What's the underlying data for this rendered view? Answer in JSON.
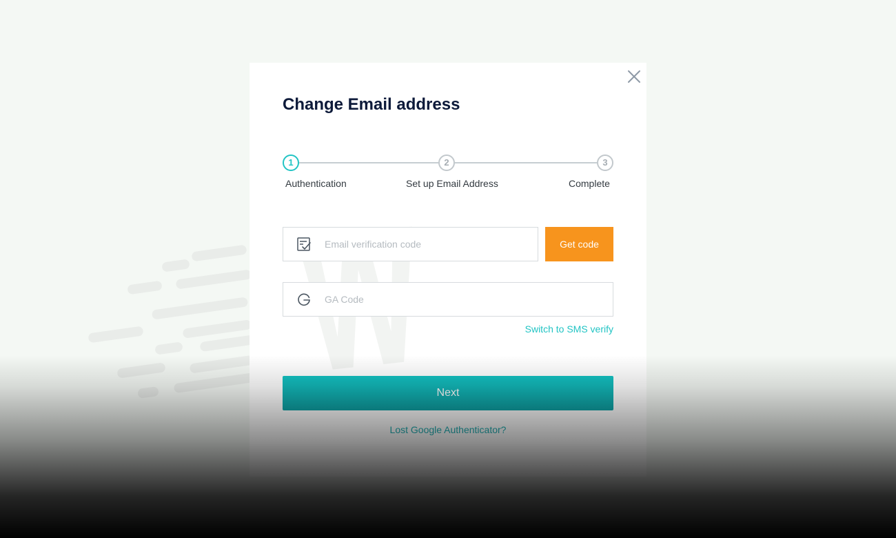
{
  "modal": {
    "title": "Change Email address",
    "close_icon": "close-icon"
  },
  "stepper": {
    "steps": [
      {
        "number": "1",
        "label": "Authentication",
        "state": "active"
      },
      {
        "number": "2",
        "label": "Set up Email Address",
        "state": "inactive"
      },
      {
        "number": "3",
        "label": "Complete",
        "state": "inactive"
      }
    ]
  },
  "email_code": {
    "placeholder": "Email verification code",
    "value": "",
    "icon": "email-verify-icon",
    "button_label": "Get code"
  },
  "ga_code": {
    "placeholder": "GA Code",
    "value": "",
    "icon": "google-icon"
  },
  "links": {
    "switch_sms": "Switch to SMS verify",
    "lost_ga": "Lost Google Authenticator?"
  },
  "actions": {
    "next_label": "Next"
  },
  "colors": {
    "accent": "#21c4c4",
    "orange": "#f7941d",
    "title": "#0d1a3a"
  }
}
